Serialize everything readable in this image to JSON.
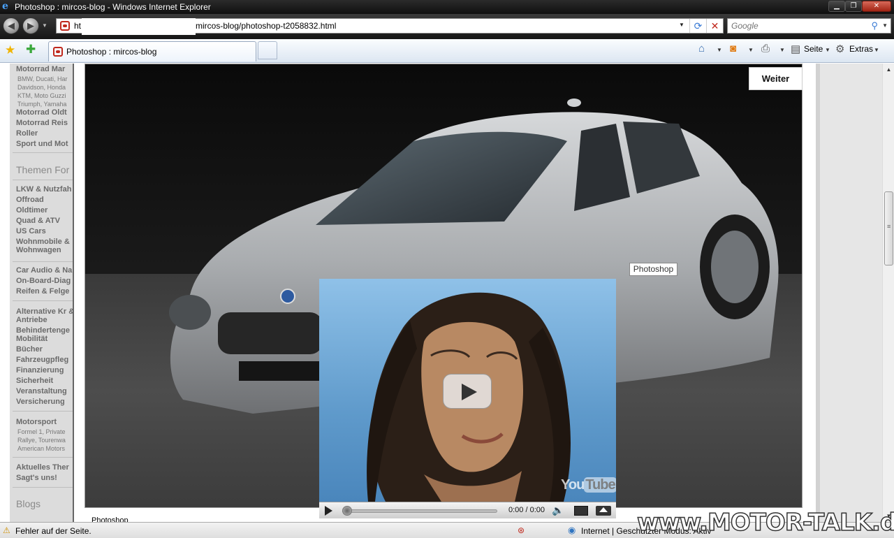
{
  "window": {
    "title": "Photoshop : mircos-blog - Windows Internet Explorer",
    "minimize_glyph": "▁",
    "maximize_glyph": "❐",
    "close_glyph": "✕"
  },
  "address_bar": {
    "url_prefix": "ht",
    "url_suffix": "mircos-blog/photoshop-t2058832.html"
  },
  "search": {
    "placeholder": "Google"
  },
  "tabs": [
    {
      "label": "Photoshop : mircos-blog",
      "active": true
    }
  ],
  "command_bar": {
    "page_label": "Seite",
    "tools_label": "Extras"
  },
  "sidebar": {
    "sections": [
      {
        "items": [
          {
            "label": "Motorrad Mar",
            "sub": "BMW, Ducati, Har Davidson, Honda KTM, Moto Guzzi Triumph, Yamaha"
          },
          {
            "label": "Motorrad Oldt"
          },
          {
            "label": "Motorrad Reis"
          },
          {
            "label": "Roller"
          },
          {
            "label": "Sport und Mot"
          }
        ]
      },
      {
        "heading": "Themen For",
        "items": [
          {
            "label": "LKW & Nutzfah"
          },
          {
            "label": "Offroad"
          },
          {
            "label": "Oldtimer"
          },
          {
            "label": "Quad & ATV"
          },
          {
            "label": "US Cars"
          },
          {
            "label": "Wohnmobile & Wohnwagen"
          },
          {
            "label": "Car Audio & Na"
          },
          {
            "label": "On-Board-Diag"
          },
          {
            "label": "Reifen & Felge"
          },
          {
            "label": "Alternative Kr & Antriebe"
          },
          {
            "label": "Behindertenge Mobilität"
          },
          {
            "label": "Bücher"
          },
          {
            "label": "Fahrzeugpfleg"
          },
          {
            "label": "Finanzierung"
          },
          {
            "label": "Sicherheit"
          },
          {
            "label": "Veranstaltung"
          },
          {
            "label": "Versicherung"
          },
          {
            "label": "Motorsport",
            "sub": "Formel 1, Private Rallye, Tourenwa American Motors"
          },
          {
            "label": "Aktuelles Ther"
          },
          {
            "label": "Sagt's uns!"
          }
        ]
      },
      {
        "heading": "Blogs"
      }
    ]
  },
  "page": {
    "next_button": "Weiter",
    "tooltip": "Photoshop",
    "image_caption": "Photoshop"
  },
  "video": {
    "time_display": "0:00 / 0:00",
    "logo_you": "You",
    "logo_tube": "Tube",
    "progress": 0
  },
  "status_bar": {
    "message": "Fehler auf der Seite.",
    "zone": "Internet | Geschützter Modus: Aktiv"
  },
  "watermark": "www.MOTOR-TALK.de",
  "colors": {
    "titlebar": "#1a1a1a",
    "tabbar": "#dce6f2",
    "sidebar": "#dcdcdc",
    "sidebar_text": "#6a6a6a",
    "close_button": "#c0281c"
  }
}
